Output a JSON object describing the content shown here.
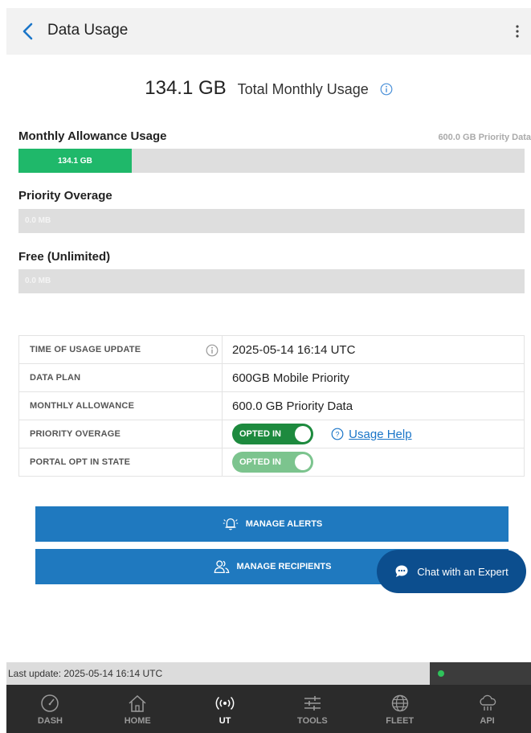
{
  "header": {
    "title": "Data Usage"
  },
  "total": {
    "value": "134.1 GB",
    "label": "Total Monthly Usage"
  },
  "monthly_allowance": {
    "label": "Monthly Allowance Usage",
    "cap_label": "600.0 GB Priority Data",
    "fill_value": "134.1 GB",
    "fill_fraction": 0.2235
  },
  "priority_overage": {
    "label": "Priority Overage",
    "value": "0.0 MB"
  },
  "free_unlimited": {
    "label": "Free (Unlimited)",
    "value": "0.0 MB"
  },
  "table": {
    "rows": [
      {
        "key": "TIME OF USAGE UPDATE",
        "value": "2025-05-14 16:14 UTC"
      },
      {
        "key": "DATA PLAN",
        "value": "600GB Mobile Priority"
      },
      {
        "key": "MONTHLY ALLOWANCE",
        "value": "600.0 GB Priority Data"
      },
      {
        "key": "PRIORITY OVERAGE",
        "toggle": "OPTED IN",
        "help": "Usage Help"
      },
      {
        "key": "PORTAL OPT IN STATE",
        "toggle": "OPTED IN"
      }
    ]
  },
  "buttons": {
    "manage_alerts": "MANAGE ALERTS",
    "manage_recipients": "MANAGE RECIPIENTS"
  },
  "chat": {
    "label": "Chat with an Expert"
  },
  "status": {
    "text": "Last update: 2025-05-14 16:14 UTC"
  },
  "nav": {
    "items": [
      {
        "label": "DASH",
        "icon": "gauge-icon"
      },
      {
        "label": "HOME",
        "icon": "home-icon"
      },
      {
        "label": "UT",
        "icon": "signal-icon",
        "active": true
      },
      {
        "label": "TOOLS",
        "icon": "sliders-icon"
      },
      {
        "label": "FLEET",
        "icon": "globe-icon"
      },
      {
        "label": "API",
        "icon": "cloud-icon"
      }
    ]
  },
  "colors": {
    "accent": "#1f79bf",
    "usage_fill": "#1fb86a",
    "toggle_on": "#1d8a3e",
    "chat": "#0c4e8e",
    "nav_bg": "#2b2b2b"
  }
}
